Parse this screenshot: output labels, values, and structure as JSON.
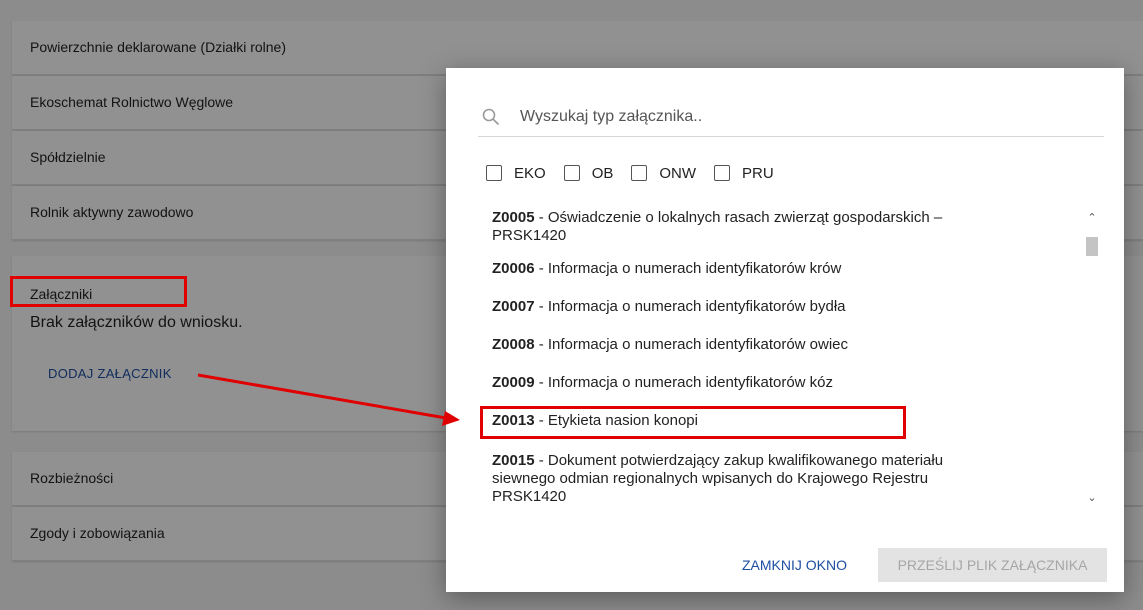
{
  "background": {
    "sections_top": [
      "Powierzchnie deklarowane (Działki rolne)",
      "Ekoschemat Rolnictwo Węglowe",
      "Spółdzielnie",
      "Rolnik aktywny zawodowo"
    ],
    "attachments": {
      "title": "Załączniki",
      "empty_text": "Brak załączników do wniosku.",
      "add_button": "DODAJ ZAŁĄCZNIK"
    },
    "sections_bottom": [
      "Rozbieżności",
      "Zgody i zobowiązania"
    ]
  },
  "modal": {
    "search": {
      "placeholder": "Wyszukaj typ załącznika.."
    },
    "filters": [
      "EKO",
      "OB",
      "ONW",
      "PRU"
    ],
    "items": [
      {
        "code": "Z0005",
        "text": " - Oświadczenie o lokalnych rasach zwierząt gospodarskich –",
        "text2": "PRSK1420"
      },
      {
        "code": "Z0006",
        "text": " - Informacja o numerach identyfikatorów krów",
        "text2": ""
      },
      {
        "code": "Z0007",
        "text": " - Informacja o numerach identyfikatorów bydła",
        "text2": ""
      },
      {
        "code": "Z0008",
        "text": " - Informacja o numerach identyfikatorów owiec",
        "text2": ""
      },
      {
        "code": "Z0009",
        "text": " - Informacja o numerach identyfikatorów kóz",
        "text2": ""
      },
      {
        "code": "Z0013",
        "text": " - Etykieta nasion konopi",
        "text2": ""
      },
      {
        "code": "Z0015",
        "text": " - Dokument potwierdzający zakup kwalifikowanego materiału",
        "text2": "siewnego odmian regionalnych wpisanych do Krajowego Rejestru",
        "text3": "PRSK1420"
      }
    ],
    "close_button": "ZAMKNIJ OKNO",
    "upload_button": "PRZEŚLIJ PLIK ZAŁĄCZNIKA"
  },
  "colors": {
    "link_blue": "#1e4fa3",
    "highlight_red": "#e00000"
  }
}
